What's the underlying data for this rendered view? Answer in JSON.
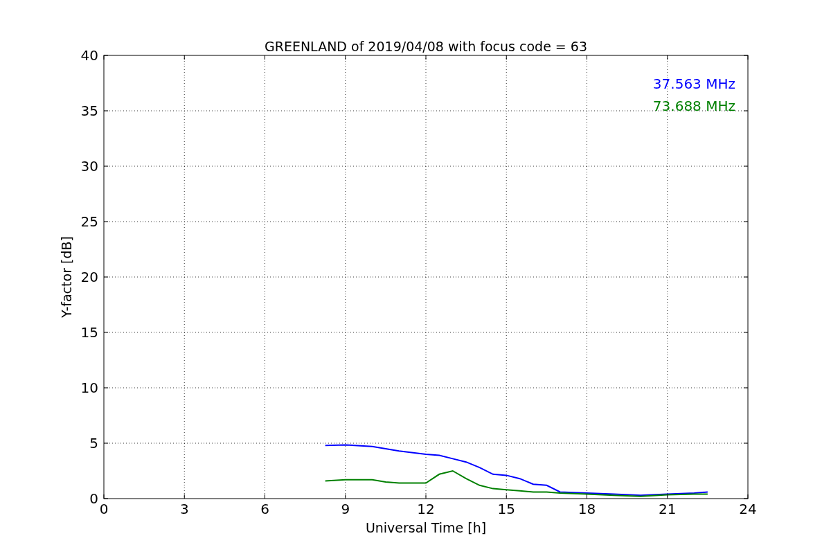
{
  "figure": {
    "chart_data": {
      "type": "line",
      "title": "GREENLAND of 2019/04/08 with focus code = 63",
      "xlabel": "Universal Time [h]",
      "ylabel": "Y-factor [dB]",
      "x": [
        8.25,
        9,
        10,
        10.5,
        11,
        12,
        12.5,
        13,
        13.5,
        14,
        14.5,
        15,
        15.5,
        16,
        16.5,
        17,
        18,
        19,
        20,
        21,
        22,
        22.5
      ],
      "series": [
        {
          "name": "37.563 MHz",
          "color": "#0000ff",
          "values": [
            4.8,
            4.85,
            4.7,
            4.5,
            4.3,
            4.0,
            3.9,
            3.6,
            3.3,
            2.8,
            2.2,
            2.1,
            1.8,
            1.3,
            1.2,
            0.6,
            0.5,
            0.4,
            0.3,
            0.4,
            0.5,
            0.6
          ]
        },
        {
          "name": "73.688 MHz",
          "color": "#008000",
          "values": [
            1.6,
            1.7,
            1.7,
            1.5,
            1.4,
            1.4,
            2.2,
            2.5,
            1.8,
            1.2,
            0.9,
            0.8,
            0.7,
            0.6,
            0.6,
            0.5,
            0.4,
            0.3,
            0.2,
            0.35,
            0.4,
            0.4
          ]
        }
      ],
      "grid": true,
      "xlim": [
        0,
        24
      ],
      "ylim": [
        0,
        40
      ],
      "xticks": [
        0,
        3,
        6,
        9,
        12,
        15,
        18,
        21,
        24
      ],
      "yticks": [
        0,
        5,
        10,
        15,
        20,
        25,
        30,
        35,
        40
      ]
    }
  }
}
